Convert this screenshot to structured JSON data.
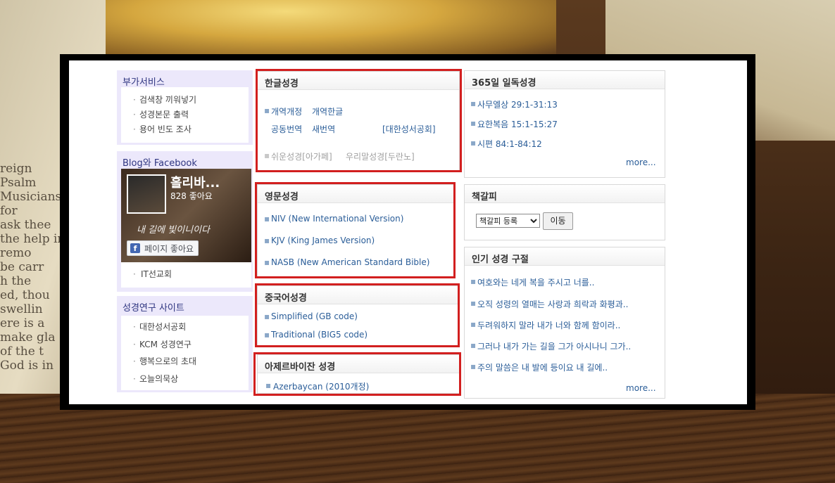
{
  "background": {
    "book_words": [
      "reign",
      "Psalm",
      "Musicians for",
      "ask thee",
      "the help in",
      "remo",
      "be carr",
      "h the",
      "ed, thou",
      "swellin",
      "ere is a",
      "make gla",
      "of the t",
      "God is in"
    ]
  },
  "left": {
    "extra_services": {
      "title": "부가서비스",
      "items": [
        "검색창 끼워넣기",
        "성경본문 출력",
        "용어 빈도 조사"
      ]
    },
    "blog": {
      "title": "Blog와 Facebook",
      "fb_name": "홀리바...",
      "fb_likes": "828 좋아요",
      "fb_slogan": "내 길에 빛이니이다",
      "fb_button": "페이지 좋아요",
      "fb_icon": "f",
      "items": [
        "IT선교회"
      ]
    },
    "research": {
      "title": "성경연구 사이트",
      "items": [
        "대한성서공회",
        "KCM 성경연구",
        "행복으로의 초대",
        "오늘의묵상"
      ]
    }
  },
  "korean": {
    "title": "한글성경",
    "row1": [
      "개역개정",
      "개역한글"
    ],
    "row2": [
      "공동번역",
      "새번역"
    ],
    "publisher": "[대한성서공회]",
    "row3": [
      "쉬운성경[아가페]",
      "우리말성경[두란노]"
    ]
  },
  "english": {
    "title": "영문성경",
    "items": [
      "NIV (New International Version)",
      "KJV (King James Version)",
      "NASB (New American Standard Bible)"
    ]
  },
  "chinese": {
    "title": "중국어성경",
    "items": [
      "Simplified (GB code)",
      "Traditional (BIG5 code)"
    ]
  },
  "azerbaijani": {
    "title": "아제르바이잔 성경",
    "items": [
      "Azerbaycan (2010개정)"
    ]
  },
  "daily": {
    "title": "365일 일독성경",
    "items": [
      "사무엘상 29:1-31:13",
      "요한복음 15:1-15:27",
      "시편 84:1-84:12"
    ],
    "more": "more..."
  },
  "bookmark": {
    "title": "책갈피",
    "select_value": "책갈피 등록",
    "button": "이동"
  },
  "popular": {
    "title": "인기 성경 구절",
    "items": [
      "여호와는 네게 복을 주시고 너를..",
      "오직 성령의 열매는 사랑과 희락과 화평과..",
      "두려워하지 말라 내가 너와 함께 함이라..",
      "그러나 내가 가는 길을 그가 아시나니 그가..",
      "주의 말씀은 내 발에 등이요 내 길에.."
    ],
    "more": "more..."
  },
  "colors": {
    "highlight": "#d21f1f",
    "link": "#2a5d98",
    "sidebar": "#ece8fb"
  }
}
